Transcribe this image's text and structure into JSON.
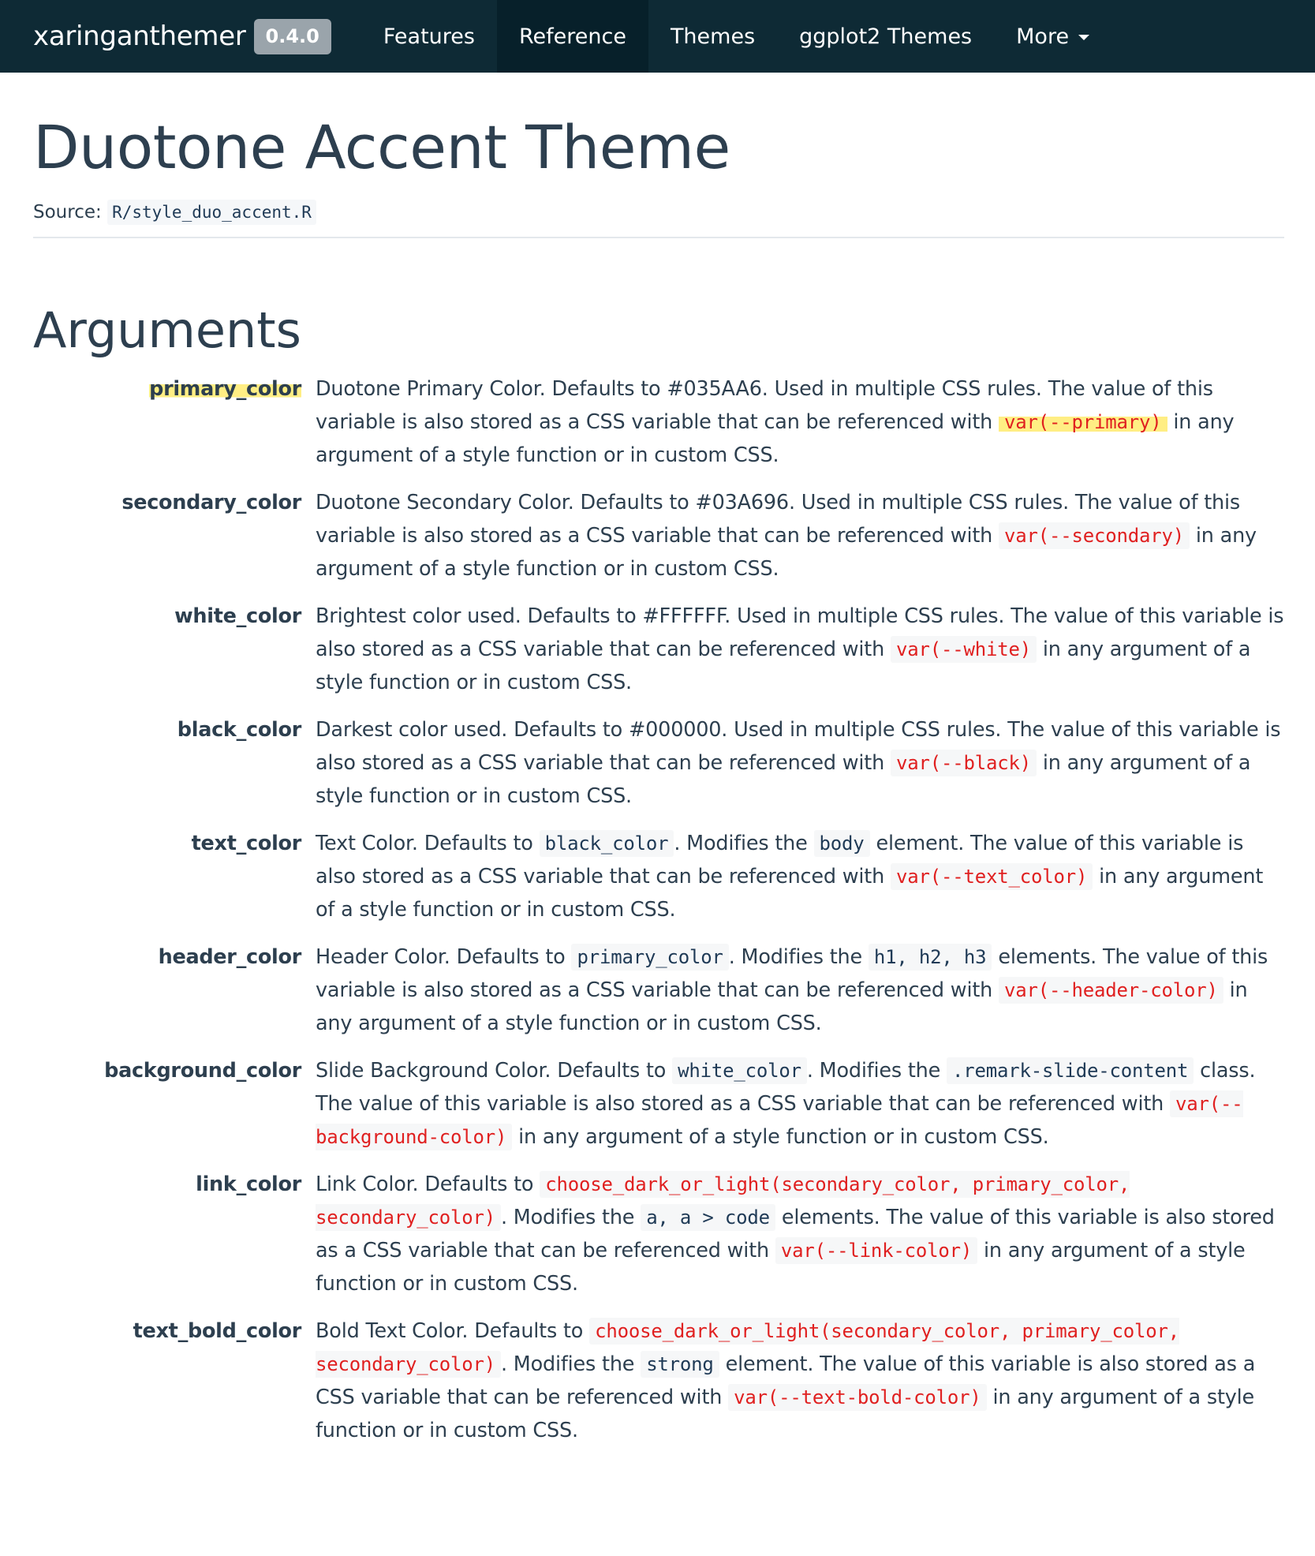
{
  "navbar": {
    "brand": "xaringanthemer",
    "version": "0.4.0",
    "items": [
      {
        "label": "Features"
      },
      {
        "label": "Reference"
      },
      {
        "label": "Themes"
      },
      {
        "label": "ggplot2 Themes"
      },
      {
        "label": "More"
      }
    ],
    "active": "Reference"
  },
  "page": {
    "title": "Duotone Accent Theme",
    "source_label": "Source:",
    "source_file": "R/style_duo_accent.R",
    "section_title": "Arguments"
  },
  "args": [
    {
      "name": "primary_color",
      "p1": "Duotone Primary Color. Defaults to #035AA6. Used in multiple CSS rules. The value of this variable is also stored as a CSS variable that can be referenced with ",
      "c1": "var(--primary)",
      "p2": " in any argument of a style function or in custom CSS."
    },
    {
      "name": "secondary_color",
      "p1": "Duotone Secondary Color. Defaults to #03A696. Used in multiple CSS rules. The value of this variable is also stored as a CSS variable that can be referenced with ",
      "c1": "var(--secondary)",
      "p2": " in any argument of a style function or in custom CSS."
    },
    {
      "name": "white_color",
      "p1": "Brightest color used. Defaults to #FFFFFF. Used in multiple CSS rules. The value of this variable is also stored as a CSS variable that can be referenced with ",
      "c1": "var(--white)",
      "p2": " in any argument of a style function or in custom CSS."
    },
    {
      "name": "black_color",
      "p1": "Darkest color used. Defaults to #000000. Used in multiple CSS rules. The value of this variable is also stored as a CSS variable that can be referenced with ",
      "c1": "var(--black)",
      "p2": " in any argument of a style function or in custom CSS."
    },
    {
      "name": "text_color",
      "p1": "Text Color. Defaults to ",
      "c1": "black_color",
      "p2": ". Modifies the ",
      "c2": "body",
      "p3": " element. The value of this variable is also stored as a CSS variable that can be referenced with ",
      "c3": "var(--text_color)",
      "p4": " in any argument of a style function or in custom CSS."
    },
    {
      "name": "header_color",
      "p1": "Header Color. Defaults to ",
      "c1": "primary_color",
      "p2": ". Modifies the ",
      "c2": "h1, h2, h3",
      "p3": " elements. The value of this variable is also stored as a CSS variable that can be referenced with ",
      "c3": "var(--header-color)",
      "p4": " in any argument of a style function or in custom CSS."
    },
    {
      "name": "background_color",
      "p1": "Slide Background Color. Defaults to ",
      "c1": "white_color",
      "p2": ". Modifies the ",
      "c2": ".remark-slide-content",
      "p3": " class. The value of this variable is also stored as a CSS variable that can be referenced with ",
      "c3": "var(--background-color)",
      "p4": " in any argument of a style function or in custom CSS."
    },
    {
      "name": "link_color",
      "p1": "Link Color. Defaults to ",
      "c1": "choose_dark_or_light(secondary_color, primary_color, secondary_color)",
      "p2": ". Modifies the ",
      "c2": "a, a > code",
      "p3": " elements. The value of this variable is also stored as a CSS variable that can be referenced with ",
      "c3": "var(--link-color)",
      "p4": " in any argument of a style function or in custom CSS."
    },
    {
      "name": "text_bold_color",
      "p1": "Bold Text Color. Defaults to ",
      "c1": "choose_dark_or_light(secondary_color, primary_color, secondary_color)",
      "p2": ". Modifies the ",
      "c2": "strong",
      "p3": " element. The value of this variable is also stored as a CSS variable that can be referenced with ",
      "c3": "var(--text-bold-color)",
      "p4": " in any argument of a style function or in custom CSS."
    }
  ],
  "colors": {
    "navbar_bg": "#0e2a35",
    "navbar_active": "#07202a",
    "code_red": "#e02020",
    "highlight": "#ffe85a"
  }
}
